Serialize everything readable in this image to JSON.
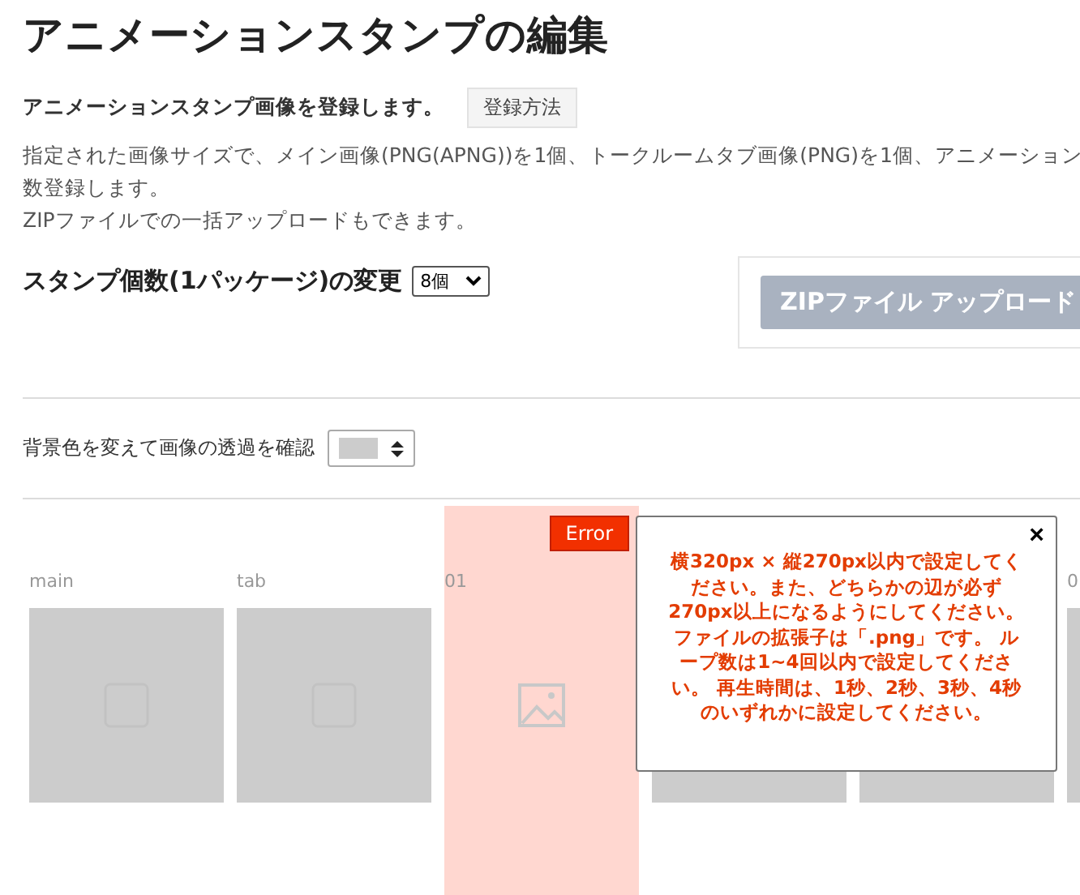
{
  "title": "アニメーションスタンプの編集",
  "intro": {
    "text": "アニメーションスタンプ画像を登録します。",
    "button": "登録方法"
  },
  "description": [
    "指定された画像サイズで、メイン画像(PNG(APNG))を1個、トークルームタブ画像(PNG)を1個、アニメーション",
    "数登録します。",
    "ZIPファイルでの一括アップロードもできます。"
  ],
  "count_section": {
    "label": "スタンプ個数(1パッケージ)の変更",
    "select_value": "8個"
  },
  "zip_button": "ZIPファイル アップロード",
  "background_check": {
    "label": "背景色を変えて画像の透過を確認"
  },
  "tiles": [
    {
      "label": "main",
      "error": false
    },
    {
      "label": "tab",
      "error": false
    },
    {
      "label": "01",
      "error": true
    },
    {
      "error": false
    },
    {
      "error": false
    },
    {
      "label": "0",
      "error": false
    }
  ],
  "error_badge": "Error",
  "error_popup": {
    "close": "×",
    "paragraphs": [
      "横320px × 縦270px以内で設定してください。また、どちらかの辺が必ず270px以上になるようにしてください。",
      "ファイルの拡張子は「.png」です。 ループ数は1~4回以内で設定してください。 再生時間は、1秒、2秒、3秒、4秒のいずれかに設定してください。"
    ]
  }
}
